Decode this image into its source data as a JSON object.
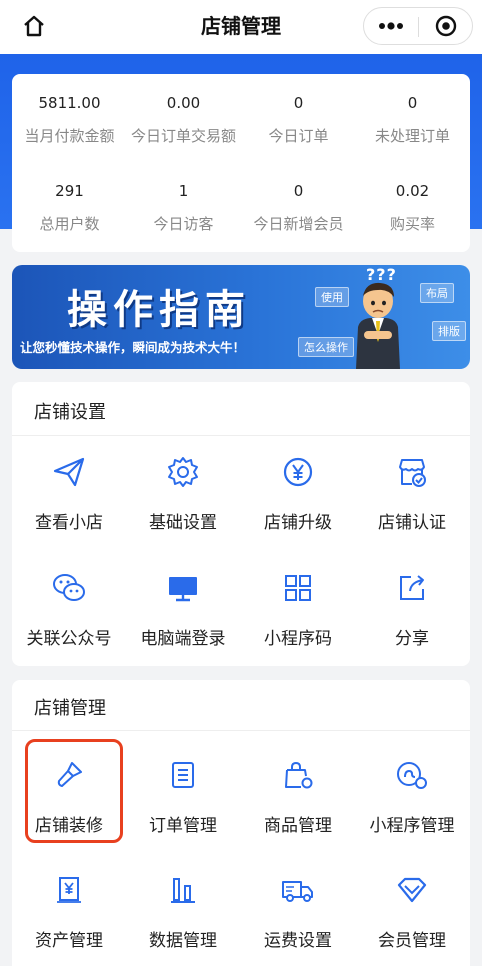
{
  "nav": {
    "title": "店铺管理"
  },
  "stats": [
    {
      "value": "5811.00",
      "label": "当月付款金额"
    },
    {
      "value": "0.00",
      "label": "今日订单交易额"
    },
    {
      "value": "0",
      "label": "今日订单"
    },
    {
      "value": "0",
      "label": "未处理订单"
    },
    {
      "value": "291",
      "label": "总用户数"
    },
    {
      "value": "1",
      "label": "今日访客"
    },
    {
      "value": "0",
      "label": "今日新增会员"
    },
    {
      "value": "0.02",
      "label": "购买率"
    }
  ],
  "banner": {
    "title": "操作指南",
    "subtitle": "让您秒懂技术操作，瞬间成为技术大牛！",
    "tags": [
      "使用",
      "布局",
      "排版",
      "怎么操作"
    ],
    "character_question": "???"
  },
  "shop_settings": {
    "title": "店铺设置",
    "items": [
      {
        "label": "查看小店",
        "icon": "paper-plane-icon"
      },
      {
        "label": "基础设置",
        "icon": "gear-icon"
      },
      {
        "label": "店铺升级",
        "icon": "yen-circle-icon"
      },
      {
        "label": "店铺认证",
        "icon": "store-verified-icon"
      },
      {
        "label": "关联公众号",
        "icon": "wechat-icon"
      },
      {
        "label": "电脑端登录",
        "icon": "monitor-icon"
      },
      {
        "label": "小程序码",
        "icon": "qrcode-icon"
      },
      {
        "label": "分享",
        "icon": "share-icon"
      }
    ]
  },
  "shop_management": {
    "title": "店铺管理",
    "items": [
      {
        "label": "店铺装修",
        "icon": "brush-icon"
      },
      {
        "label": "订单管理",
        "icon": "order-list-icon"
      },
      {
        "label": "商品管理",
        "icon": "product-bag-icon"
      },
      {
        "label": "小程序管理",
        "icon": "miniprogram-settings-icon"
      },
      {
        "label": "资产管理",
        "icon": "assets-icon"
      },
      {
        "label": "数据管理",
        "icon": "bar-chart-icon"
      },
      {
        "label": "运费设置",
        "icon": "truck-icon"
      },
      {
        "label": "会员管理",
        "icon": "diamond-icon"
      }
    ]
  },
  "colors": {
    "accent": "#2a6bea",
    "header_blue": "#2268ec",
    "highlight": "#e8401f"
  }
}
